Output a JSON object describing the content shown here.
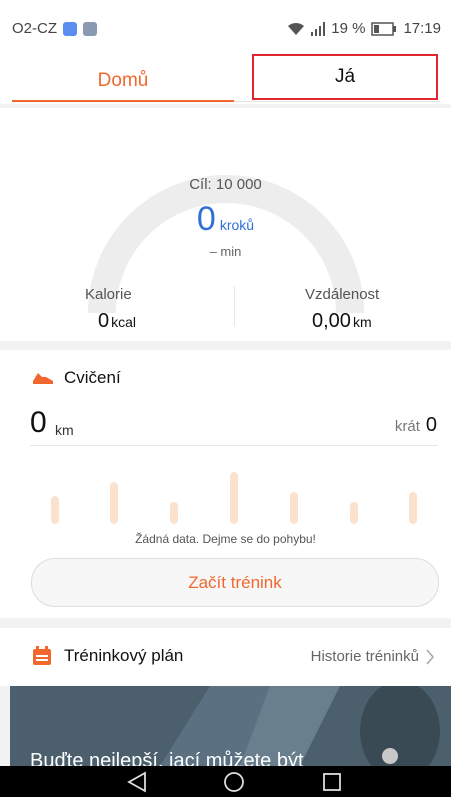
{
  "status": {
    "carrier": "O2-CZ",
    "battery": "19 %",
    "time": "17:19"
  },
  "tabs": {
    "home": "Domů",
    "me": "Já"
  },
  "summary": {
    "goal": "Cíl: 10 000",
    "steps": "0",
    "steps_unit": "kroků",
    "minutes": "– min",
    "calories_label": "Kalorie",
    "calories_value": "0",
    "calories_unit": "kcal",
    "distance_label": "Vzdálenost",
    "distance_value": "0,00",
    "distance_unit": "km"
  },
  "exercise": {
    "title": "Cvičení",
    "km_value": "0",
    "km_unit": "km",
    "times_label": "krát",
    "times_value": "0",
    "no_data": "Žádná data. Dejme se do pohybu!",
    "start_button": "Začít trénink"
  },
  "plan": {
    "title": "Tréninkový plán",
    "history": "Historie tréninků"
  },
  "banner": {
    "text": "Buďte nejlepší, jací můžete být"
  },
  "colors": {
    "accent": "#f2672e",
    "blue": "#2f6fd6",
    "highlight": "#e0262e"
  }
}
